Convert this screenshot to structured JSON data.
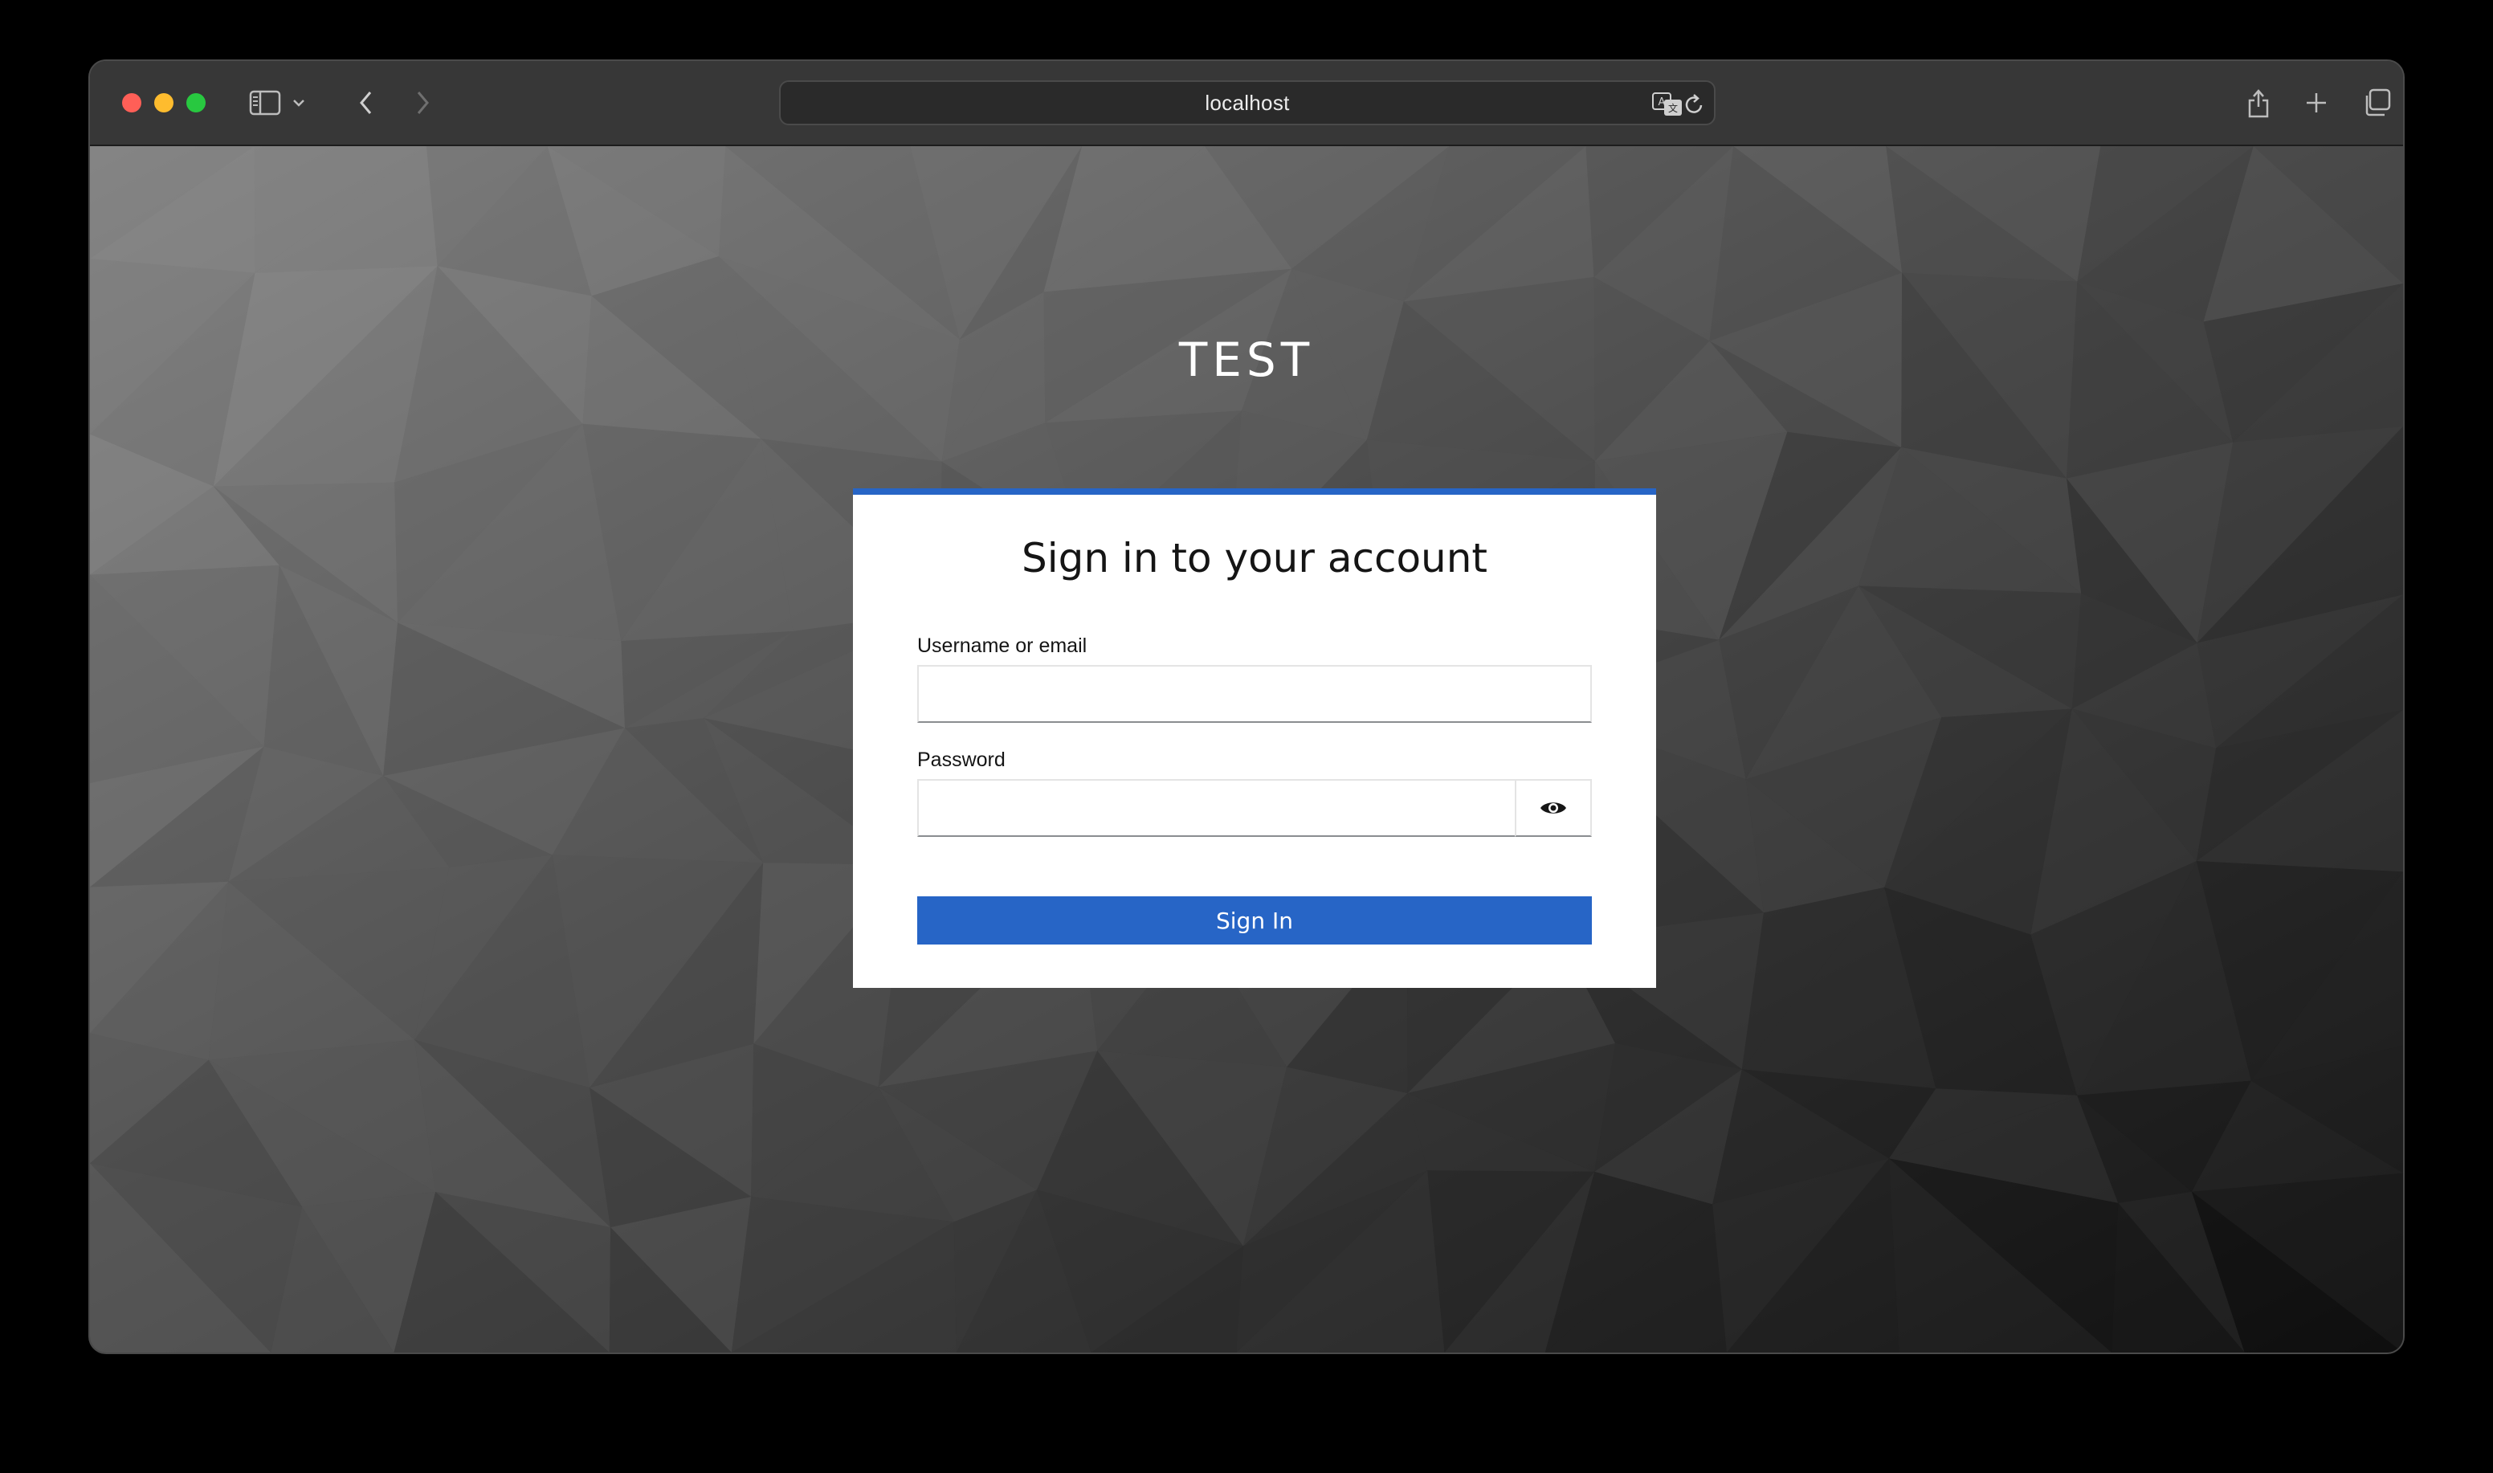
{
  "browser": {
    "address": "localhost",
    "icons": {
      "sidebar": "sidebar-icon",
      "chevron": "chevron-down-icon",
      "back": "back-arrow-icon",
      "forward": "forward-arrow-icon",
      "translate": "translate-icon",
      "reload": "reload-icon",
      "share": "share-icon",
      "new_tab": "plus-icon",
      "tab_overview": "tabs-icon"
    }
  },
  "page": {
    "realm_title": "TEST",
    "card_title": "Sign in to your account",
    "username_label": "Username or email",
    "username_value": "",
    "password_label": "Password",
    "password_value": "",
    "show_password_icon": "eye-icon",
    "sign_in_label": "Sign In"
  },
  "colors": {
    "accent": "#2765c6",
    "card": "#ffffff",
    "window_toolbar": "#373737"
  }
}
